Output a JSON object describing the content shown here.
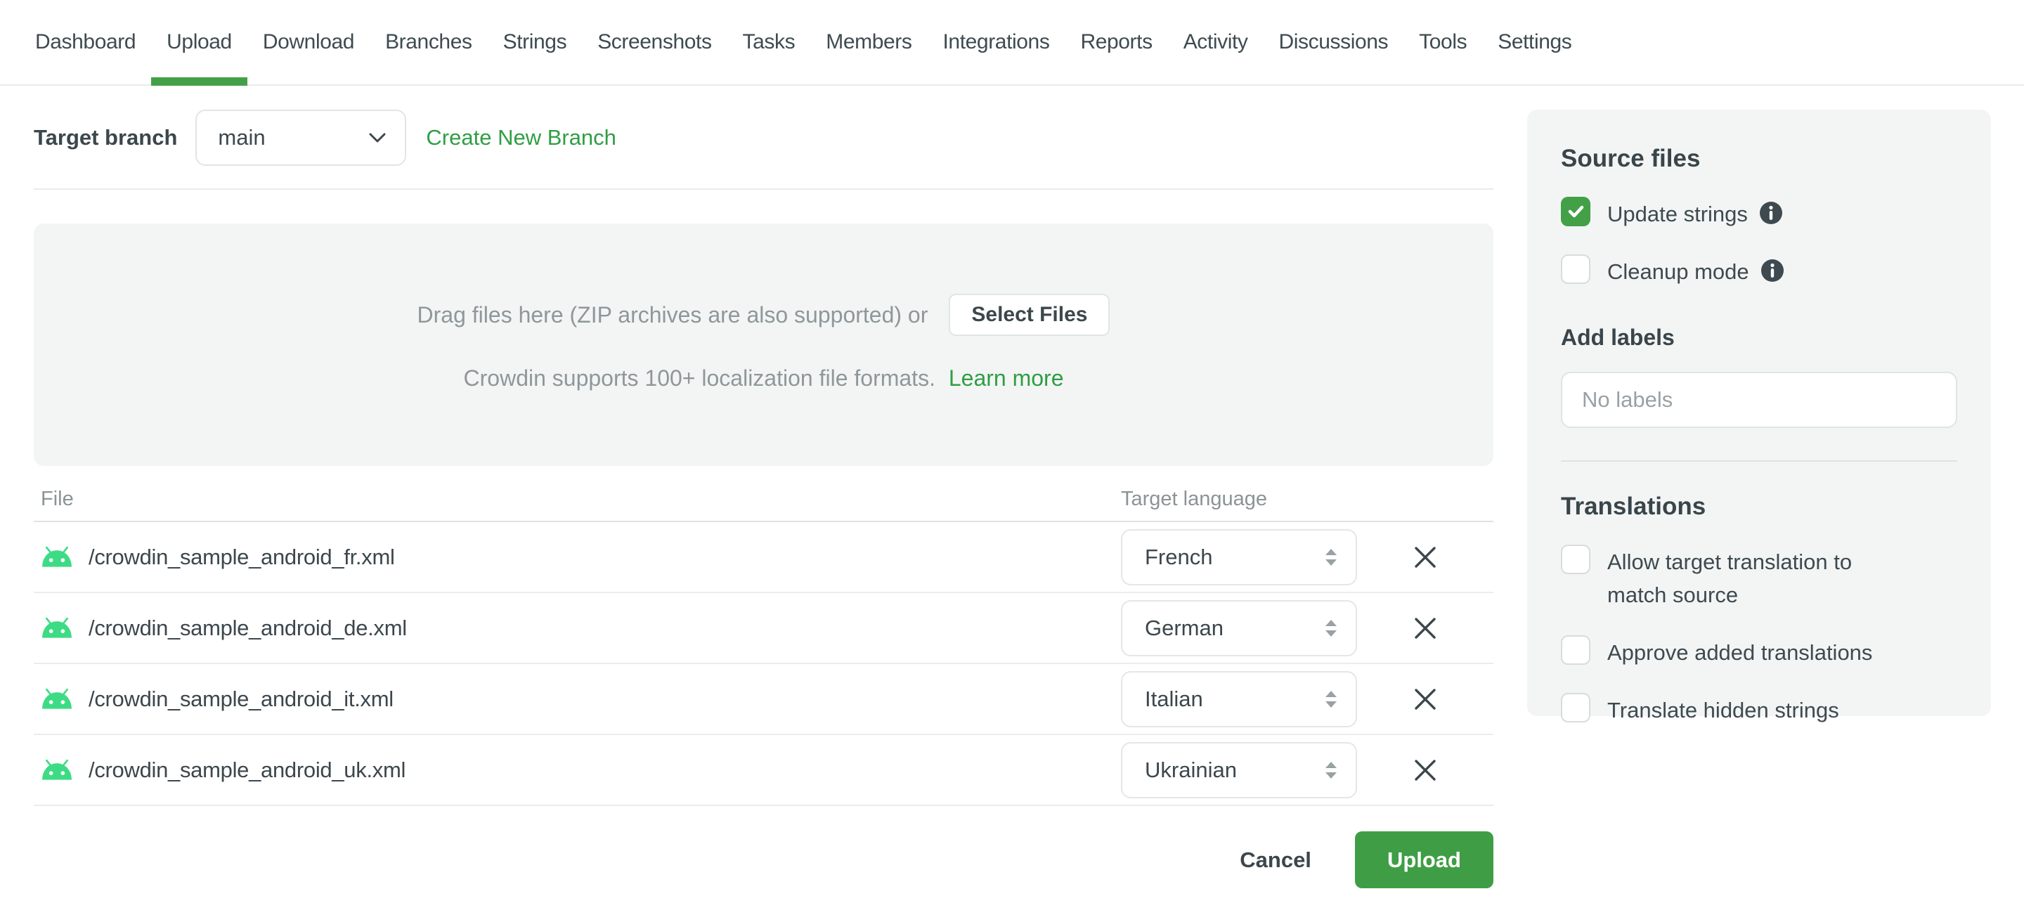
{
  "nav": {
    "items": [
      {
        "label": "Dashboard",
        "active": false
      },
      {
        "label": "Upload",
        "active": true
      },
      {
        "label": "Download",
        "active": false
      },
      {
        "label": "Branches",
        "active": false
      },
      {
        "label": "Strings",
        "active": false
      },
      {
        "label": "Screenshots",
        "active": false
      },
      {
        "label": "Tasks",
        "active": false
      },
      {
        "label": "Members",
        "active": false
      },
      {
        "label": "Integrations",
        "active": false
      },
      {
        "label": "Reports",
        "active": false
      },
      {
        "label": "Activity",
        "active": false
      },
      {
        "label": "Discussions",
        "active": false
      },
      {
        "label": "Tools",
        "active": false
      },
      {
        "label": "Settings",
        "active": false
      }
    ]
  },
  "branch": {
    "label": "Target branch",
    "selected": "main",
    "create_link": "Create New Branch"
  },
  "dropzone": {
    "text": "Drag files here (ZIP archives are also supported) or",
    "select_files_label": "Select Files",
    "formats_text": "Crowdin supports 100+ localization file formats.",
    "learn_more_label": "Learn more"
  },
  "table": {
    "columns": {
      "file": "File",
      "language": "Target language"
    },
    "rows": [
      {
        "file": "/crowdin_sample_android_fr.xml",
        "language": "French"
      },
      {
        "file": "/crowdin_sample_android_de.xml",
        "language": "German"
      },
      {
        "file": "/crowdin_sample_android_it.xml",
        "language": "Italian"
      },
      {
        "file": "/crowdin_sample_android_uk.xml",
        "language": "Ukrainian"
      }
    ]
  },
  "actions": {
    "cancel_label": "Cancel",
    "upload_label": "Upload"
  },
  "sidebar": {
    "source_files": {
      "title": "Source files",
      "options": [
        {
          "label": "Update strings",
          "checked": true,
          "has_info": true
        },
        {
          "label": "Cleanup mode",
          "checked": false,
          "has_info": true
        }
      ]
    },
    "labels": {
      "title": "Add labels",
      "placeholder": "No labels"
    },
    "translations": {
      "title": "Translations",
      "options": [
        {
          "label": "Allow target translation to match source",
          "checked": false
        },
        {
          "label": "Approve added translations",
          "checked": false
        },
        {
          "label": "Translate hidden strings",
          "checked": false
        }
      ]
    }
  },
  "colors": {
    "accent_green": "#43a047",
    "button_green": "#3f9e45",
    "link_green": "#2f9e44",
    "android_green": "#3ddc84",
    "text_dark": "#3c474c",
    "text_muted": "#8c9396"
  }
}
